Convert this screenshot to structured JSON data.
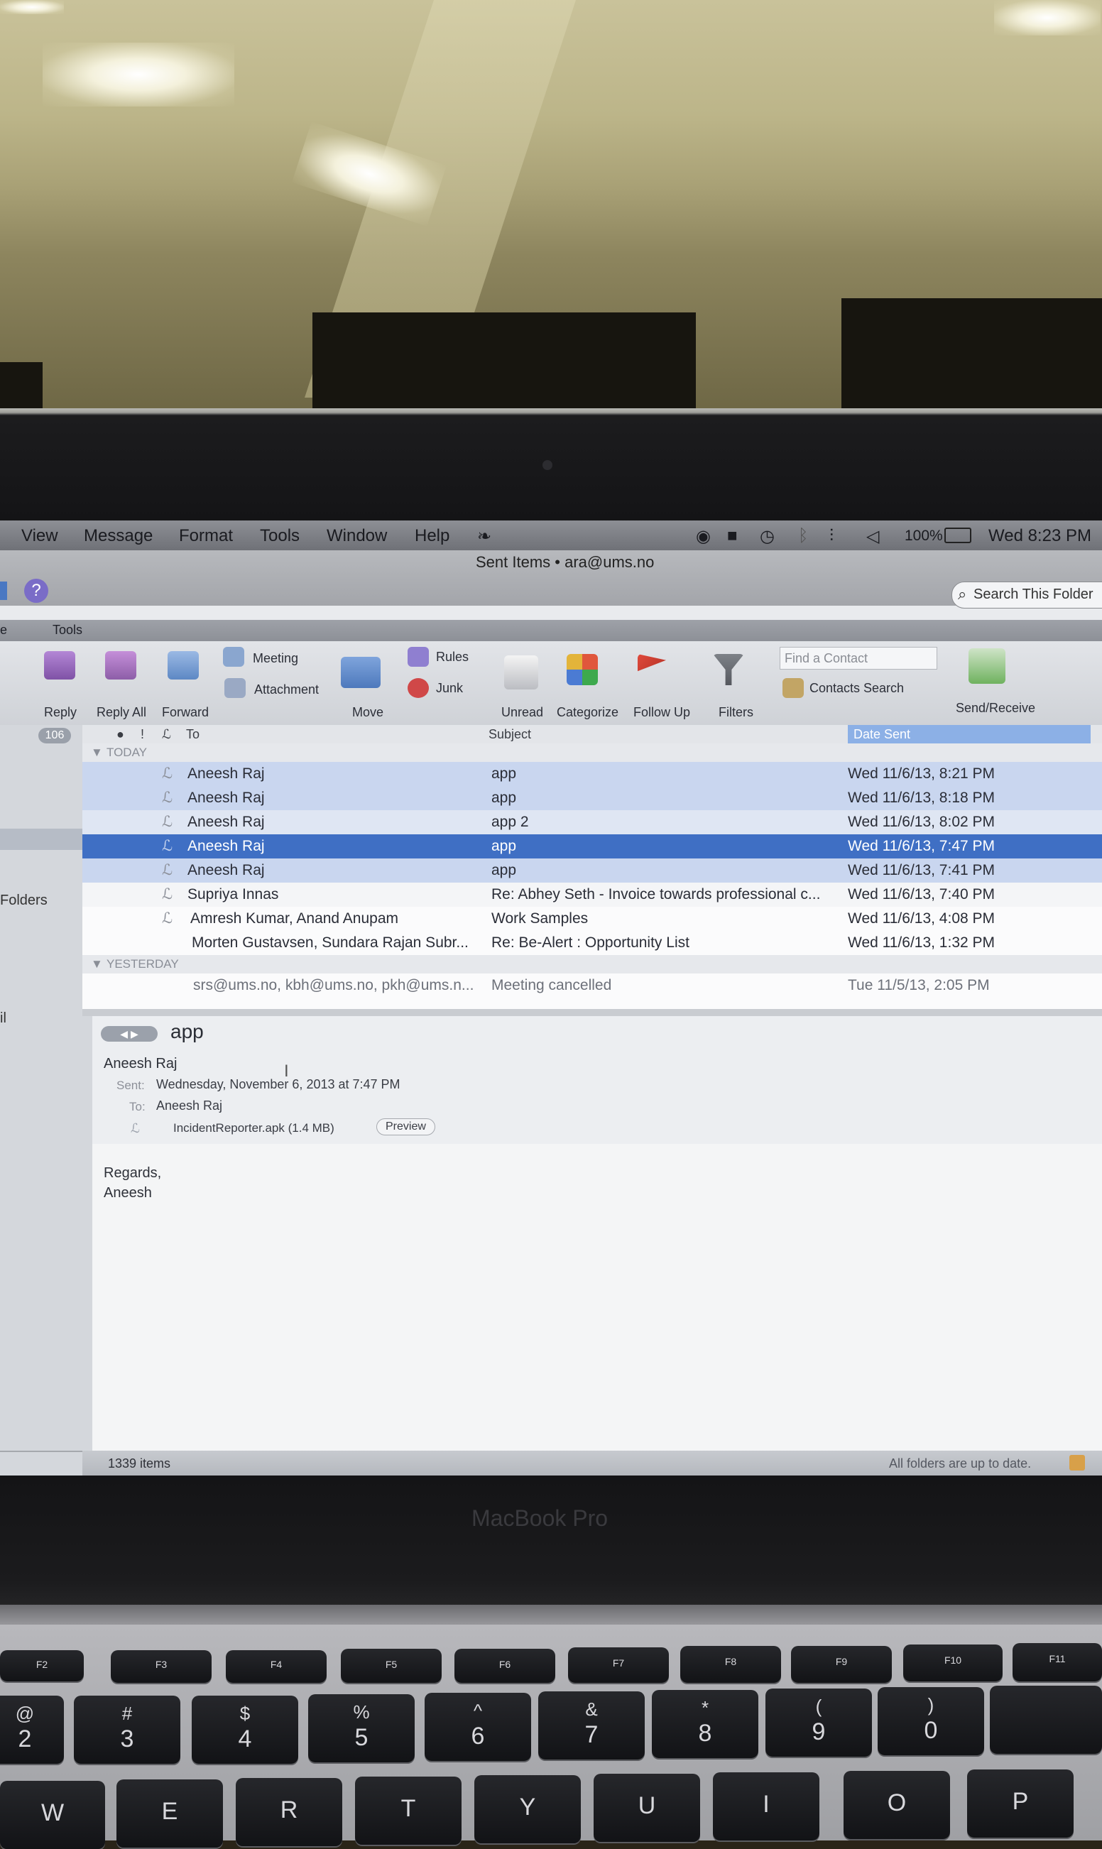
{
  "menubar": {
    "items": [
      "View",
      "Message",
      "Format",
      "Tools",
      "Window",
      "Help"
    ],
    "battery": "100%",
    "clock": "Wed 8:23 PM"
  },
  "window": {
    "title": "Sent Items • ara@ums.no",
    "search_placeholder": "Search This Folder",
    "tabs": [
      "Tools"
    ]
  },
  "ribbon": {
    "reply": "Reply",
    "reply_all": "Reply All",
    "forward": "Forward",
    "meeting": "Meeting",
    "attachment": "Attachment",
    "move": "Move",
    "rules": "Rules",
    "junk": "Junk",
    "unread": "Unread",
    "categorize": "Categorize",
    "follow_up": "Follow Up",
    "filters": "Filters",
    "find_contact_placeholder": "Find a Contact",
    "contacts_search": "Contacts Search",
    "send_receive": "Send/Receive"
  },
  "sidebar": {
    "badge": "106",
    "folders_label": "Folders",
    "il_label": "il"
  },
  "list": {
    "columns": [
      "To",
      "Subject",
      "Date Sent"
    ],
    "group_today": "TODAY",
    "group_yesterday": "YESTERDAY",
    "rows": [
      {
        "to": "Aneesh Raj",
        "subject": "app",
        "date": "Wed 11/6/13, 8:21 PM"
      },
      {
        "to": "Aneesh Raj",
        "subject": "app",
        "date": "Wed 11/6/13, 8:18 PM"
      },
      {
        "to": "Aneesh Raj",
        "subject": "app 2",
        "date": "Wed 11/6/13, 8:02 PM"
      },
      {
        "to": "Aneesh Raj",
        "subject": "app",
        "date": "Wed 11/6/13, 7:47 PM"
      },
      {
        "to": "Aneesh Raj",
        "subject": "app",
        "date": "Wed 11/6/13, 7:41 PM"
      },
      {
        "to": "Supriya Innas",
        "subject": "Re: Abhey Seth - Invoice towards professional c...",
        "date": "Wed 11/6/13, 7:40 PM"
      },
      {
        "to": "Amresh Kumar, Anand Anupam",
        "subject": "Work Samples",
        "date": "Wed 11/6/13, 4:08 PM"
      },
      {
        "to": "Morten Gustavsen, Sundara Rajan Subr...",
        "subject": "Re: Be-Alert : Opportunity List",
        "date": "Wed 11/6/13, 1:32 PM"
      }
    ],
    "yesterday_row": {
      "to": "srs@ums.no, kbh@ums.no, pkh@ums.n...",
      "subject": "Meeting cancelled",
      "date": "Tue 11/5/13, 2:05 PM"
    }
  },
  "reading": {
    "subject": "app",
    "from": "Aneesh Raj",
    "sent_label": "Sent:",
    "sent_value": "Wednesday, November 6, 2013 at 7:47 PM",
    "to_label": "To:",
    "to_value": "Aneesh Raj",
    "attachment": "IncidentReporter.apk (1.4 MB)",
    "preview_button": "Preview",
    "body_line1": "Regards,",
    "body_line2": "Aneesh"
  },
  "status": {
    "items_count": "1339 items",
    "sync": "All folders are up to date."
  },
  "laptop": {
    "brand": "MacBook Pro"
  },
  "keyboard": {
    "fn_row": [
      "F2",
      "F3",
      "F4",
      "F5",
      "F6",
      "F7",
      "F8",
      "F9",
      "F10",
      "F11"
    ],
    "num_row": [
      {
        "shift": "@",
        "key": "2"
      },
      {
        "shift": "#",
        "key": "3"
      },
      {
        "shift": "$",
        "key": "4"
      },
      {
        "shift": "%",
        "key": "5"
      },
      {
        "shift": "^",
        "key": "6"
      },
      {
        "shift": "&",
        "key": "7"
      },
      {
        "shift": "*",
        "key": "8"
      },
      {
        "shift": "(",
        "key": "9"
      },
      {
        "shift": ")",
        "key": "0"
      }
    ],
    "letter_row": [
      "W",
      "E",
      "R",
      "T",
      "Y",
      "U",
      "I",
      "O",
      "P"
    ]
  },
  "colors": {
    "selection": "#3f6fc4",
    "selection_light": "#c9d6ef",
    "flag": "#d0392b"
  }
}
